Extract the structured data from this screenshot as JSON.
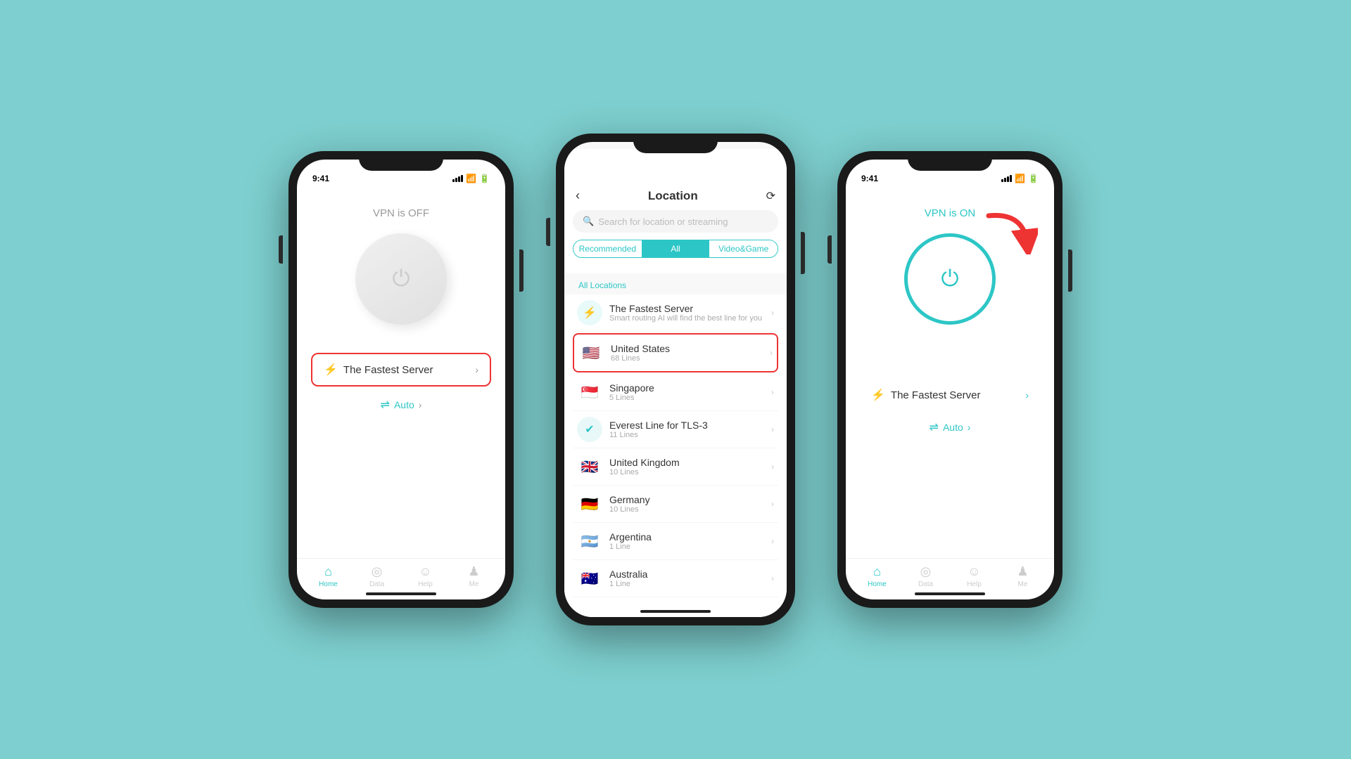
{
  "bg_color": "#7ecfcf",
  "accent": "#2dc6c6",
  "phone1": {
    "time": "9:41",
    "vpn_status": "VPN is OFF",
    "server_label": "The Fastest Server",
    "auto_label": "Auto",
    "nav": [
      {
        "icon": "⌂",
        "label": "Home",
        "active": true
      },
      {
        "icon": "◎",
        "label": "Data",
        "active": false
      },
      {
        "icon": "☺",
        "label": "Help",
        "active": false
      },
      {
        "icon": "♟",
        "label": "Me",
        "active": false
      }
    ]
  },
  "phone2": {
    "header_title": "Location",
    "search_placeholder": "Search for location or streaming",
    "tabs": [
      {
        "label": "Recommended",
        "active": false
      },
      {
        "label": "All",
        "active": true
      },
      {
        "label": "Video&Game",
        "active": false
      }
    ],
    "section_label": "All Locations",
    "locations": [
      {
        "name": "The Fastest Server",
        "sub": "Smart routing AI will find the best line for you",
        "type": "fastest",
        "flag": "⚡"
      },
      {
        "name": "United States",
        "sub": "68 Lines",
        "flag": "🇺🇸",
        "selected": true
      },
      {
        "name": "Singapore",
        "sub": "5 Lines",
        "flag": "🇸🇬",
        "selected": false
      },
      {
        "name": "Everest Line for TLS-3",
        "sub": "11 Lines",
        "flag": "✔",
        "type": "tls",
        "selected": false
      },
      {
        "name": "United Kingdom",
        "sub": "10 Lines",
        "flag": "🇬🇧",
        "selected": false
      },
      {
        "name": "Germany",
        "sub": "10 Lines",
        "flag": "🇩🇪",
        "selected": false
      },
      {
        "name": "Argentina",
        "sub": "1 Line",
        "flag": "🇦🇷",
        "selected": false
      },
      {
        "name": "Australia",
        "sub": "1 Line",
        "flag": "🇦🇺",
        "selected": false
      }
    ]
  },
  "phone3": {
    "time": "9:41",
    "vpn_status": "VPN is ON",
    "server_label": "The Fastest Server",
    "auto_label": "Auto",
    "nav": [
      {
        "icon": "⌂",
        "label": "Home",
        "active": true
      },
      {
        "icon": "◎",
        "label": "Data",
        "active": false
      },
      {
        "icon": "☺",
        "label": "Help",
        "active": false
      },
      {
        "icon": "♟",
        "label": "Me",
        "active": false
      }
    ]
  }
}
